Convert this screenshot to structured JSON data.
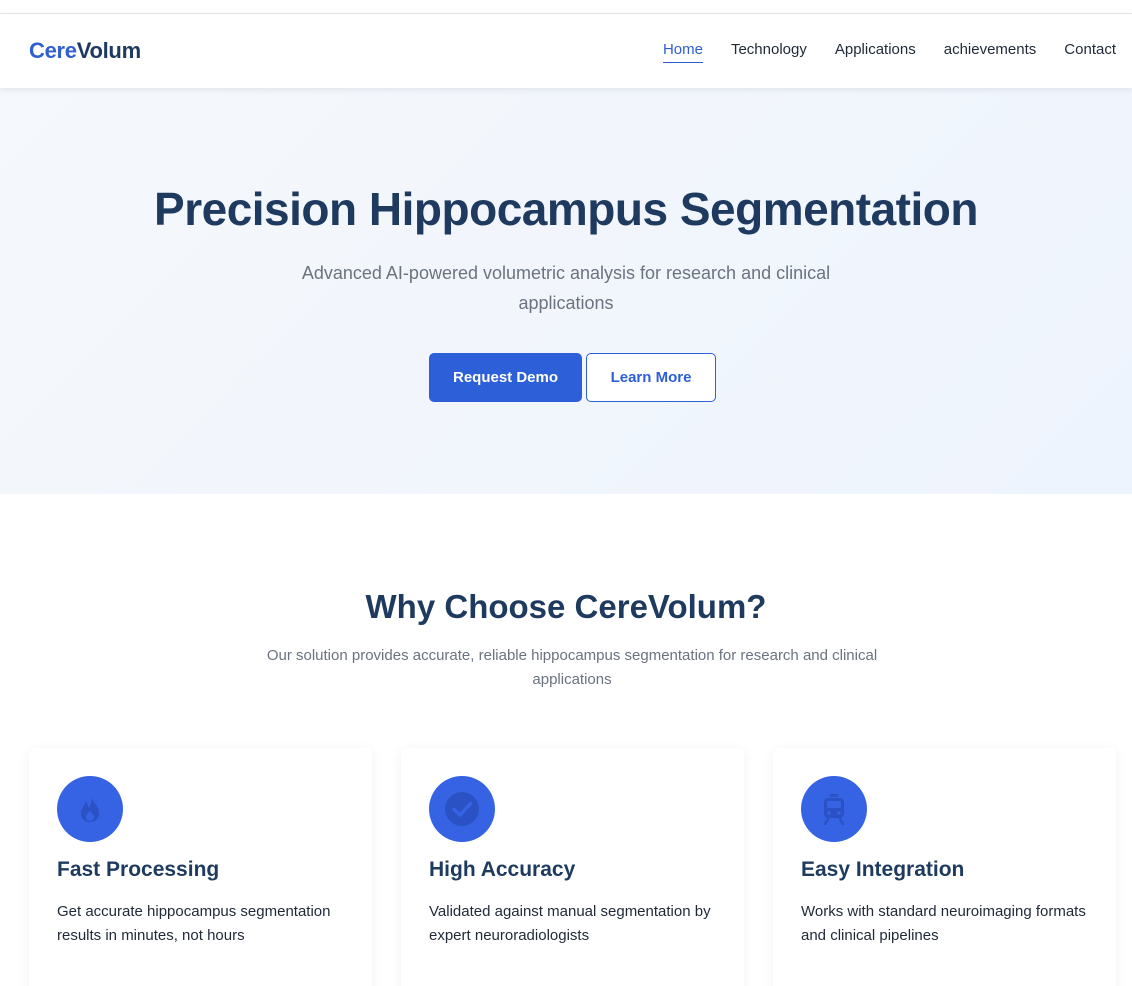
{
  "brand": {
    "part1": "Cere",
    "part2": "Volum"
  },
  "nav": {
    "items": [
      {
        "label": "Home",
        "active": true
      },
      {
        "label": "Technology",
        "active": false
      },
      {
        "label": "Applications",
        "active": false
      },
      {
        "label": "achievements",
        "active": false
      },
      {
        "label": "Contact",
        "active": false
      }
    ]
  },
  "hero": {
    "title": "Precision Hippocampus Segmentation",
    "subtitle": "Advanced AI-powered volumetric analysis for research and clinical applications",
    "primary_button": "Request Demo",
    "secondary_button": "Learn More"
  },
  "why": {
    "title": "Why Choose CereVolum?",
    "subtitle": "Our solution provides accurate, reliable hippocampus segmentation for research and clinical applications"
  },
  "features": [
    {
      "icon": "fire-icon",
      "title": "Fast Processing",
      "text": "Get accurate hippocampus segmentation results in minutes, not hours"
    },
    {
      "icon": "check-circle-icon",
      "title": "High Accuracy",
      "text": "Validated against manual segmentation by expert neuroradiologists"
    },
    {
      "icon": "train-icon",
      "title": "Easy Integration",
      "text": "Works with standard neuroimaging formats and clinical pipelines"
    }
  ],
  "colors": {
    "accent": "#2d5fd8",
    "heading": "#1e3a5f",
    "muted": "#6b7280",
    "icon_circle": "#3563e4"
  }
}
